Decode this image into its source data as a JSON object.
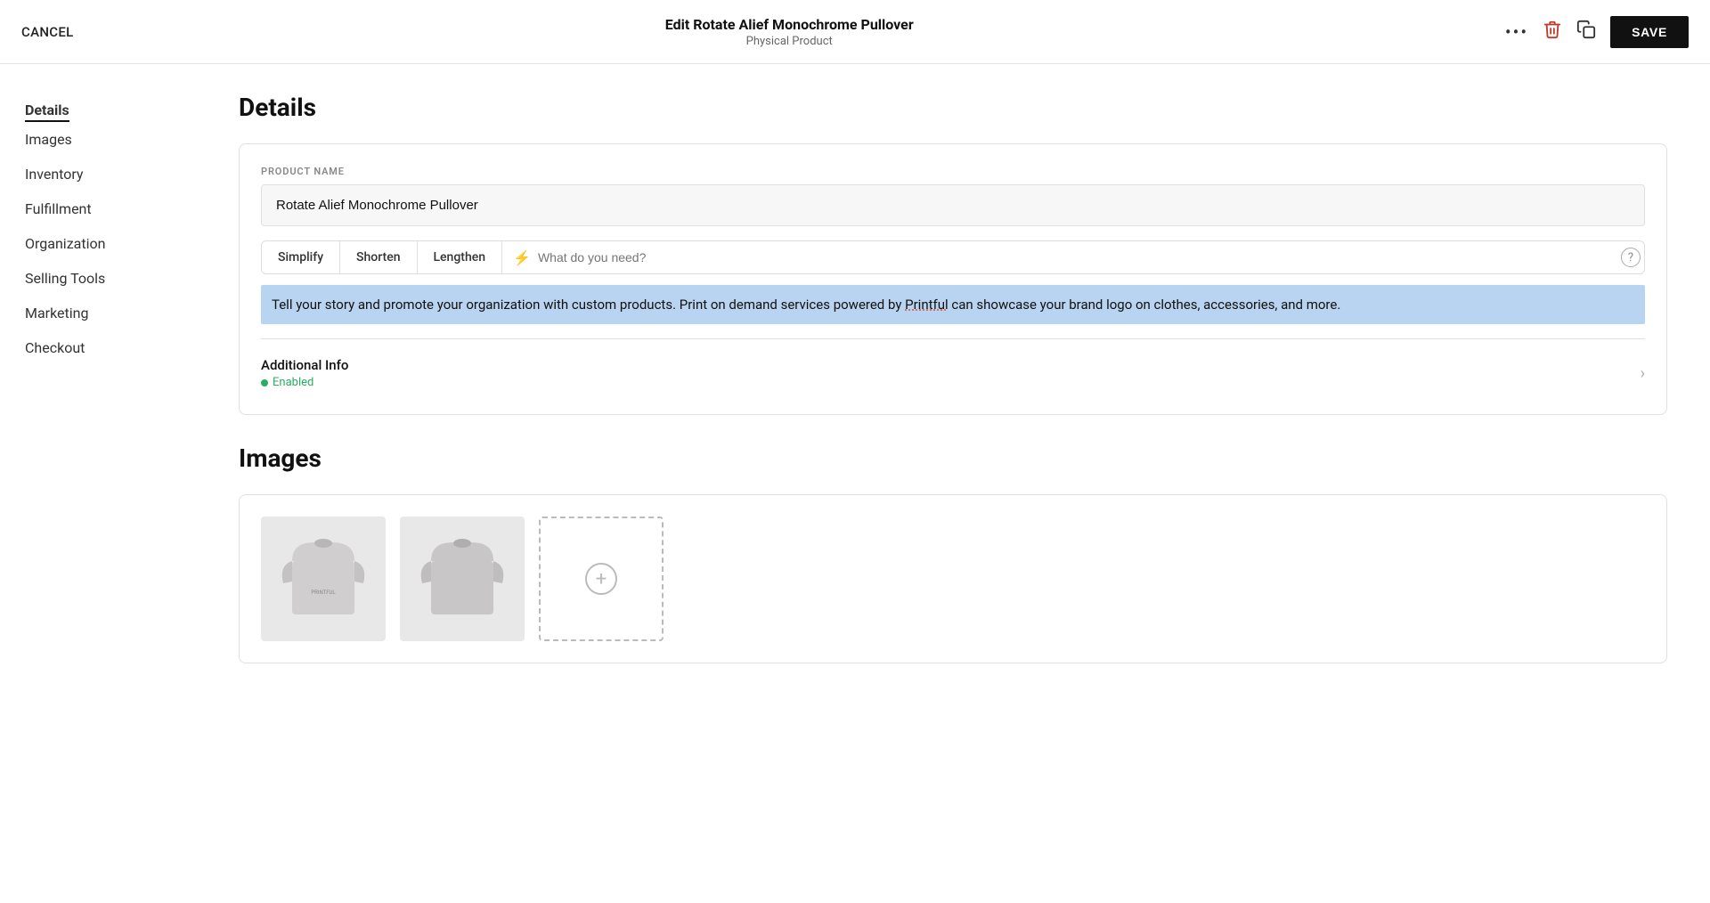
{
  "topbar": {
    "cancel_label": "CANCEL",
    "title": "Edit Rotate Alief Monochrome Pullover",
    "subtitle": "Physical Product",
    "save_label": "SAVE"
  },
  "sidebar": {
    "items": [
      {
        "id": "details",
        "label": "Details",
        "active": true
      },
      {
        "id": "images",
        "label": "Images",
        "active": false
      },
      {
        "id": "inventory",
        "label": "Inventory",
        "active": false
      },
      {
        "id": "fulfillment",
        "label": "Fulfillment",
        "active": false
      },
      {
        "id": "organization",
        "label": "Organization",
        "active": false
      },
      {
        "id": "selling-tools",
        "label": "Selling Tools",
        "active": false
      },
      {
        "id": "marketing",
        "label": "Marketing",
        "active": false
      },
      {
        "id": "checkout",
        "label": "Checkout",
        "active": false
      }
    ]
  },
  "main": {
    "details_title": "Details",
    "product_name_label": "PRODUCT NAME",
    "product_name_value": "Rotate Alief Monochrome Pullover",
    "ai_toolbar": {
      "simplify_label": "Simplify",
      "shorten_label": "Shorten",
      "lengthen_label": "Lengthen",
      "input_placeholder": "What do you need?"
    },
    "description_text": "Tell your story and promote your organization with custom products. Print on demand services powered by Printful can showcase your brand logo on clothes, accessories, and more.",
    "underline_word": "Printful",
    "additional_info": {
      "label": "Additional Info",
      "status": "Enabled"
    },
    "images_title": "Images"
  },
  "icons": {
    "more": "•••",
    "delete": "🗑",
    "duplicate": "⧉",
    "bolt": "⚡",
    "help": "?",
    "chevron_right": "›",
    "dot_enabled": "●",
    "add": "+"
  }
}
